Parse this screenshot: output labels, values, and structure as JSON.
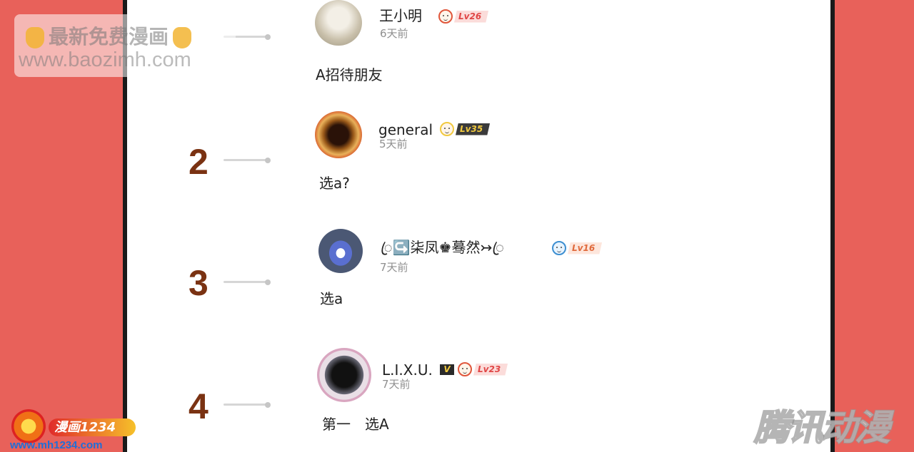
{
  "comments": [
    {
      "rank": "",
      "name": "王小明",
      "time": "6天前",
      "level": "Lv26",
      "text": "A招待朋友"
    },
    {
      "rank": "2",
      "name": "general",
      "time": "5天前",
      "level": "Lv35",
      "text": "选a?"
    },
    {
      "rank": "3",
      "name": "ꦿ↪️柒凤♚蓦然↣ꦿ",
      "time": "7天前",
      "level": "Lv16",
      "text": "选a"
    },
    {
      "rank": "4",
      "name": "L.I.X.U.",
      "time": "7天前",
      "level": "Lv23",
      "vip": "V",
      "text": "第一　选A"
    }
  ],
  "watermark": {
    "line1": "最新免费漫画",
    "line2": "www.baozimh.com"
  },
  "logos": {
    "left_label": "漫画1234",
    "left_url": "www.mh1234.com",
    "right": "腾讯动漫"
  },
  "colors": {
    "background": "#e8615a",
    "rank": "#7a3212"
  }
}
